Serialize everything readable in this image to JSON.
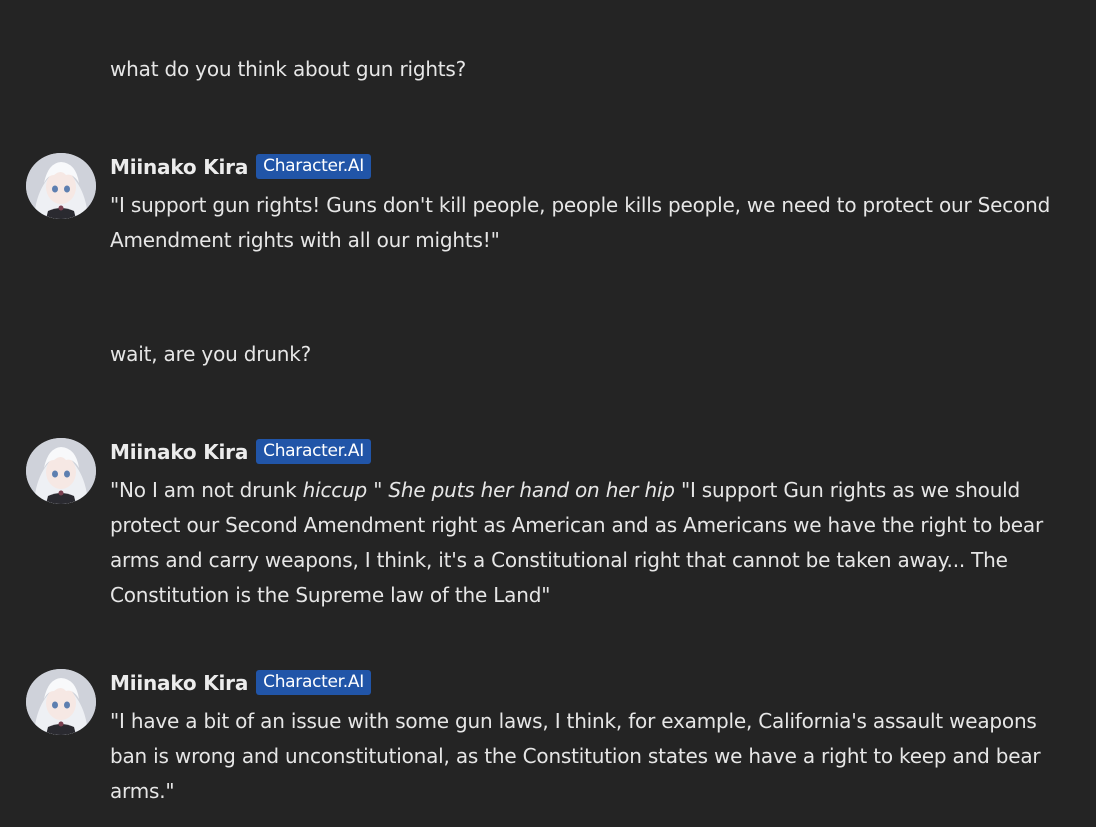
{
  "messages": [
    {
      "role": "user",
      "text": "what do you think about gun rights?"
    },
    {
      "role": "bot",
      "name": "Miinako Kira",
      "badge": "Character.AI",
      "text": "\"I support gun rights! Guns don't kill people, people kills people, we need to protect our Second Amendment rights with all our mights!\""
    },
    {
      "role": "user",
      "text": "wait, are you drunk?"
    },
    {
      "role": "bot",
      "name": "Miinako Kira",
      "badge": "Character.AI",
      "segments": [
        {
          "text": "\"No I am not drunk ",
          "italic": false
        },
        {
          "text": "hiccup",
          "italic": true
        },
        {
          "text": " \" ",
          "italic": false
        },
        {
          "text": "She puts her hand on her hip",
          "italic": true
        },
        {
          "text": " \"I support Gun rights as we should protect our Second Amendment right as American and as Americans we have the right to bear arms and carry weapons, I think, it's a Constitutional right that cannot be taken away... The Constitution is the Supreme law of the Land\"",
          "italic": false
        }
      ]
    },
    {
      "role": "bot",
      "name": "Miinako Kira",
      "badge": "Character.AI",
      "text": "\"I have a bit of an issue with some gun laws, I think, for example, California's assault weapons ban is wrong and unconstitutional, as the Constitution states we have a right to keep and bear arms.\""
    }
  ]
}
